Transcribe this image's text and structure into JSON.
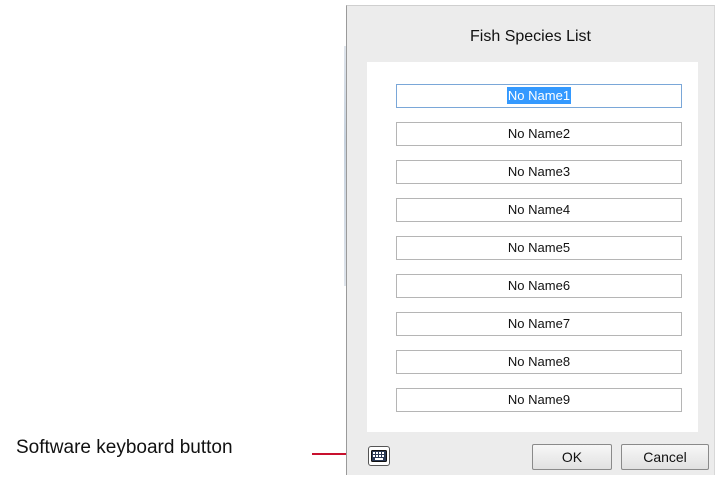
{
  "annotation": {
    "label": "Software keyboard button",
    "accent_color": "#c8102e"
  },
  "dialog": {
    "title": "Fish Species List",
    "selected_index": 0,
    "items": [
      {
        "label": "No Name1"
      },
      {
        "label": "No Name2"
      },
      {
        "label": "No Name3"
      },
      {
        "label": "No Name4"
      },
      {
        "label": "No Name5"
      },
      {
        "label": "No Name6"
      },
      {
        "label": "No Name7"
      },
      {
        "label": "No Name8"
      },
      {
        "label": "No Name9"
      }
    ],
    "keyboard_icon": "keyboard-icon",
    "ok_label": "OK",
    "cancel_label": "Cancel",
    "selection_color": "#3399ff"
  }
}
